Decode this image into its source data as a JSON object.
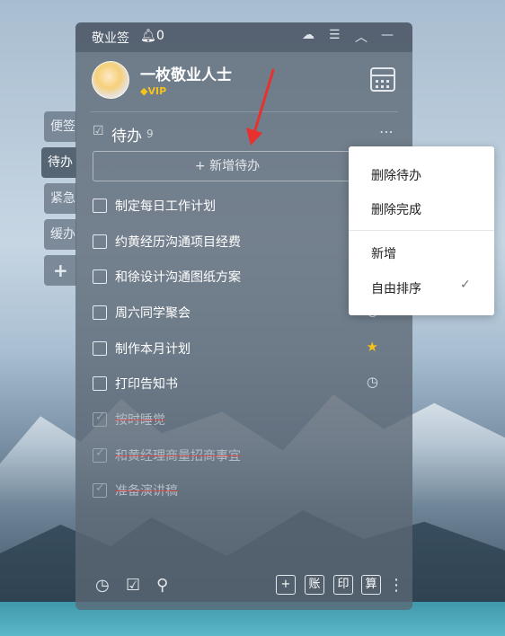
{
  "app": {
    "name": "敬业签",
    "notification_count": "0"
  },
  "side_tabs": [
    {
      "label": "便签",
      "active": false
    },
    {
      "label": "待办",
      "active": true
    },
    {
      "label": "紧急",
      "active": false
    },
    {
      "label": "缓办",
      "active": false
    },
    {
      "label": "+",
      "active": false
    }
  ],
  "user": {
    "name": "一枚敬业人士",
    "badge": "VIP"
  },
  "section": {
    "title": "待办",
    "count": "9",
    "add_button": "+ 新增待办"
  },
  "todos": [
    {
      "text": "制定每日工作计划",
      "done": false,
      "marker": ""
    },
    {
      "text": "约黄经历沟通项目经费",
      "done": false,
      "marker": ""
    },
    {
      "text": "和徐设计沟通图纸方案",
      "done": false,
      "marker": ""
    },
    {
      "text": "周六同学聚会",
      "done": false,
      "marker": "clock-icon"
    },
    {
      "text": "制作本月计划",
      "done": false,
      "marker": "star-icon"
    },
    {
      "text": "打印告知书",
      "done": false,
      "marker": "clock-icon"
    },
    {
      "text": "按时睡觉",
      "done": true,
      "marker": ""
    },
    {
      "text": "和黄经理商量招商事宜",
      "done": true,
      "marker": ""
    },
    {
      "text": "准备演讲稿",
      "done": true,
      "marker": ""
    }
  ],
  "bottom_bar": {
    "ledger": "账",
    "print": "印",
    "calc": "算"
  },
  "menu": {
    "items": [
      "删除待办",
      "删除完成",
      "新增",
      "自由排序"
    ],
    "checked_item": "自由排序"
  },
  "colors": {
    "accent_red": "#e8312f",
    "star": "#f4c21b",
    "vip": "#f6c21c"
  }
}
